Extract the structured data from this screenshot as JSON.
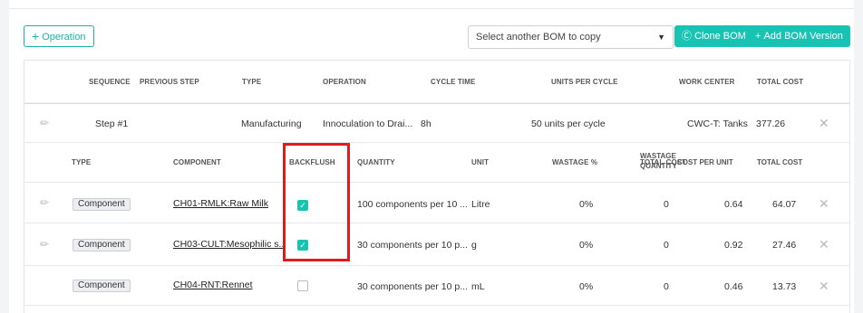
{
  "toolbar": {
    "add_operation": "Operation",
    "select_placeholder": "Select another BOM to copy",
    "clone_bom": "Clone BOM",
    "add_bom_version": "Add BOM Version"
  },
  "operations_header": [
    "SEQUENCE",
    "PREVIOUS STEP",
    "TYPE",
    "OPERATION",
    "CYCLE TIME",
    "UNITS PER CYCLE",
    "WORK CENTER",
    "TOTAL COST"
  ],
  "operation": {
    "sequence": "Step #1",
    "type": "Manufacturing",
    "operation": "Innoculation to Drai...",
    "cycle_time": "8h",
    "units_per_cycle": "50 units per cycle",
    "work_center": "CWC-T: Tanks",
    "total_cost": "377.26"
  },
  "components_header": {
    "type": "TYPE",
    "component": "COMPONENT",
    "backflush": "BACKFLUSH",
    "quantity": "QUANTITY",
    "unit": "UNIT",
    "wastage_pct": "WASTAGE %",
    "wastage_qty_1": "WASTAGE",
    "wastage_qty_2": "QUANTITY",
    "cost_per_unit": "COST PER UNIT",
    "total_cost": "TOTAL COST"
  },
  "components": [
    {
      "type": "Component",
      "component": "CH01-RMLK:Raw Milk",
      "backflush": true,
      "quantity": "100 components per 10 ...",
      "unit": "Litre",
      "wastage_pct": "0%",
      "wastage_qty": "0",
      "cost_per_unit": "0.64",
      "total_cost": "64.07"
    },
    {
      "type": "Component",
      "component": "CH03-CULT:Mesophilic s..",
      "backflush": true,
      "quantity": "30 components per 10 p...",
      "unit": "g",
      "wastage_pct": "0%",
      "wastage_qty": "0",
      "cost_per_unit": "0.92",
      "total_cost": "27.46"
    },
    {
      "type": "Component",
      "component": "CH04-RNT:Rennet",
      "backflush": false,
      "quantity": "30 components per 10 p...",
      "unit": "mL",
      "wastage_pct": "0%",
      "wastage_qty": "0",
      "cost_per_unit": "0.46",
      "total_cost": "13.73"
    }
  ],
  "colors": {
    "accent": "#19c3b3",
    "highlight": "#e11b1b"
  }
}
